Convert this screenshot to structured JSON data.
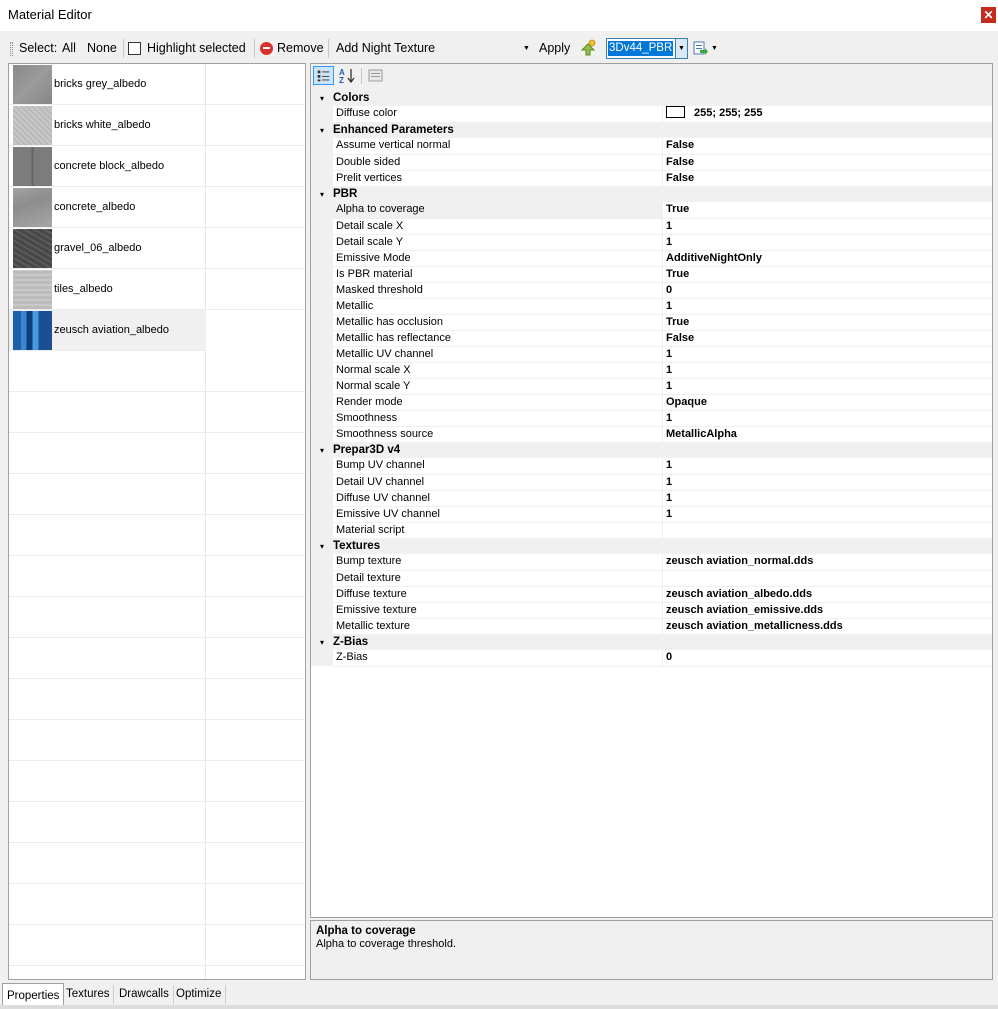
{
  "window": {
    "title": "Material Editor",
    "close_icon": "close-icon"
  },
  "toolbar": {
    "select_label": "Select:",
    "all_label": "All",
    "none_label": "None",
    "highlight_label": "Highlight selected",
    "remove_label": "Remove",
    "add_night_texture_label": "Add Night Texture",
    "apply_label": "Apply",
    "preset_value": "3Dv44_PBR"
  },
  "materials": [
    {
      "name": "bricks grey_albedo",
      "selected": false
    },
    {
      "name": "bricks white_albedo",
      "selected": false
    },
    {
      "name": "concrete block_albedo",
      "selected": false
    },
    {
      "name": "concrete_albedo",
      "selected": false
    },
    {
      "name": "gravel_06_albedo",
      "selected": false
    },
    {
      "name": "tiles_albedo",
      "selected": false
    },
    {
      "name": "zeusch aviation_albedo",
      "selected": true
    }
  ],
  "properties": [
    {
      "category": "Colors",
      "items": [
        {
          "name": "Diffuse color",
          "value": "255; 255; 255",
          "color": "#ffffff"
        }
      ]
    },
    {
      "category": "Enhanced Parameters",
      "items": [
        {
          "name": "Assume vertical normal",
          "value": "False"
        },
        {
          "name": "Double sided",
          "value": "False"
        },
        {
          "name": "Prelit vertices",
          "value": "False"
        }
      ]
    },
    {
      "category": "PBR",
      "items": [
        {
          "name": "Alpha to coverage",
          "value": "True",
          "highlighted": true
        },
        {
          "name": "Detail scale X",
          "value": "1"
        },
        {
          "name": "Detail scale Y",
          "value": "1"
        },
        {
          "name": "Emissive Mode",
          "value": "AdditiveNightOnly"
        },
        {
          "name": "Is PBR material",
          "value": "True"
        },
        {
          "name": "Masked threshold",
          "value": "0"
        },
        {
          "name": "Metallic",
          "value": "1"
        },
        {
          "name": "Metallic has occlusion",
          "value": "True"
        },
        {
          "name": "Metallic has reflectance",
          "value": "False"
        },
        {
          "name": "Metallic UV channel",
          "value": "1"
        },
        {
          "name": "Normal scale X",
          "value": "1"
        },
        {
          "name": "Normal scale Y",
          "value": "1"
        },
        {
          "name": "Render mode",
          "value": "Opaque"
        },
        {
          "name": "Smoothness",
          "value": "1"
        },
        {
          "name": "Smoothness source",
          "value": "MetallicAlpha"
        }
      ]
    },
    {
      "category": "Prepar3D v4",
      "items": [
        {
          "name": "Bump UV channel",
          "value": "1"
        },
        {
          "name": "Detail UV channel",
          "value": "1"
        },
        {
          "name": "Diffuse UV channel",
          "value": "1"
        },
        {
          "name": "Emissive UV channel",
          "value": "1"
        },
        {
          "name": "Material script",
          "value": ""
        }
      ]
    },
    {
      "category": "Textures",
      "items": [
        {
          "name": "Bump texture",
          "value": "zeusch aviation_normal.dds"
        },
        {
          "name": "Detail texture",
          "value": ""
        },
        {
          "name": "Diffuse texture",
          "value": "zeusch aviation_albedo.dds"
        },
        {
          "name": "Emissive texture",
          "value": "zeusch aviation_emissive.dds"
        },
        {
          "name": "Metallic texture",
          "value": "zeusch aviation_metallicness.dds"
        }
      ]
    },
    {
      "category": "Z-Bias",
      "items": [
        {
          "name": "Z-Bias",
          "value": "0"
        }
      ]
    }
  ],
  "help": {
    "title": "Alpha to coverage",
    "description": "Alpha to coverage threshold."
  },
  "tabs": [
    {
      "label": "Properties",
      "active": true
    },
    {
      "label": "Textures",
      "active": false
    },
    {
      "label": "Drawcalls",
      "active": false
    },
    {
      "label": "Optimize",
      "active": false
    }
  ],
  "colors": {
    "selection_blue": "#0078d7",
    "remove_red": "#d9302b",
    "close_red": "#c42b1c",
    "panel_gray": "#f0f0f0"
  }
}
